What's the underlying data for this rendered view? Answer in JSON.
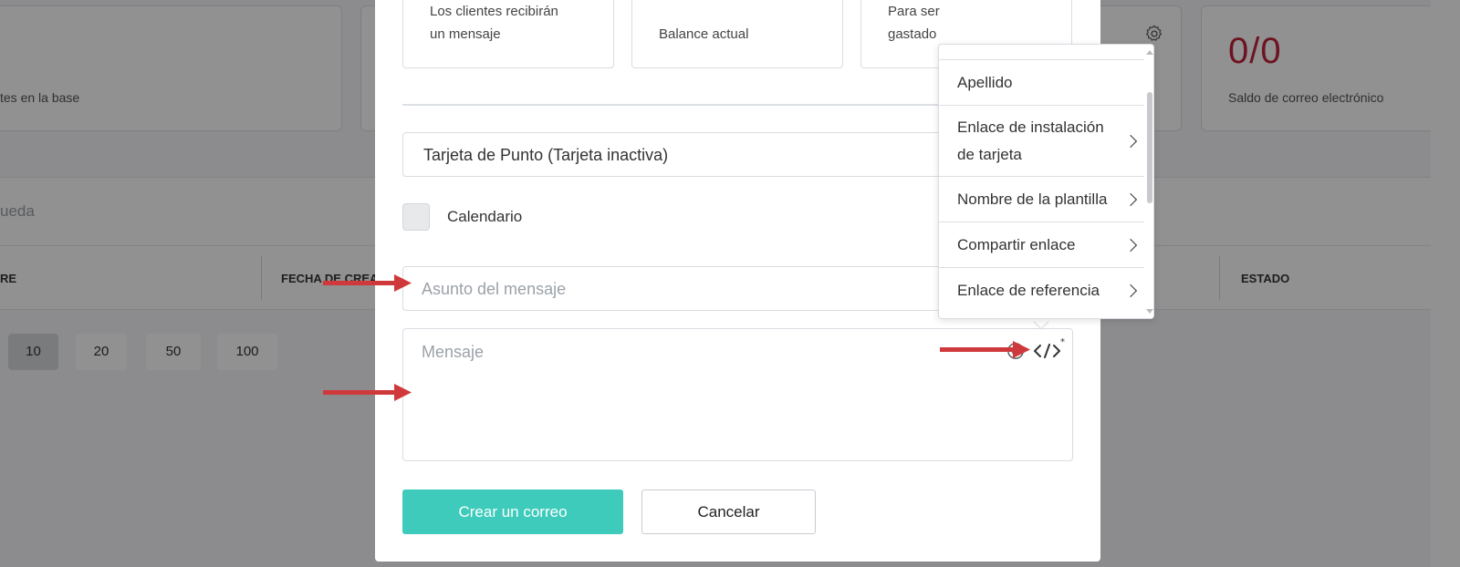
{
  "background": {
    "stats": {
      "clients_caption": "tes en la base",
      "email_balance_value": "0/0",
      "email_balance_caption": "Saldo de correo electrónico"
    },
    "search_placeholder": "ueda",
    "table_headers": {
      "name": "RE",
      "created": "FECHA DE CREA",
      "status": "ESTADO"
    },
    "pagination": [
      "10",
      "20",
      "50",
      "100"
    ],
    "pagination_active": "10"
  },
  "modal": {
    "cards": {
      "recipients_line1": "Los clientes recibirán",
      "recipients_line2": "un mensaje",
      "balance": "Balance actual",
      "to_spend_line1": "Para ser",
      "to_spend_line2": "gastado"
    },
    "card_select_value": "Tarjeta de Punto (Tarjeta inactiva)",
    "calendar_label": "Calendario",
    "subject_placeholder": "Asunto del mensaje",
    "message_placeholder": "Mensaje",
    "create_button": "Crear un correo",
    "cancel_button": "Cancelar"
  },
  "variables_dropdown": {
    "items": [
      {
        "label_line1": "Apellido",
        "label_line2": "",
        "has_submenu": false
      },
      {
        "label_line1": "Enlace de instalación",
        "label_line2": "de tarjeta",
        "has_submenu": true
      },
      {
        "label_line1": "Nombre de la plantilla",
        "label_line2": "",
        "has_submenu": true
      },
      {
        "label_line1": "Compartir enlace",
        "label_line2": "",
        "has_submenu": true
      },
      {
        "label_line1": "Enlace de referencia",
        "label_line2": "",
        "has_submenu": true
      }
    ]
  },
  "colors": {
    "accent": "#3ecbbb",
    "balance_red": "#c2223c",
    "annotation_arrow": "#d0393b"
  }
}
